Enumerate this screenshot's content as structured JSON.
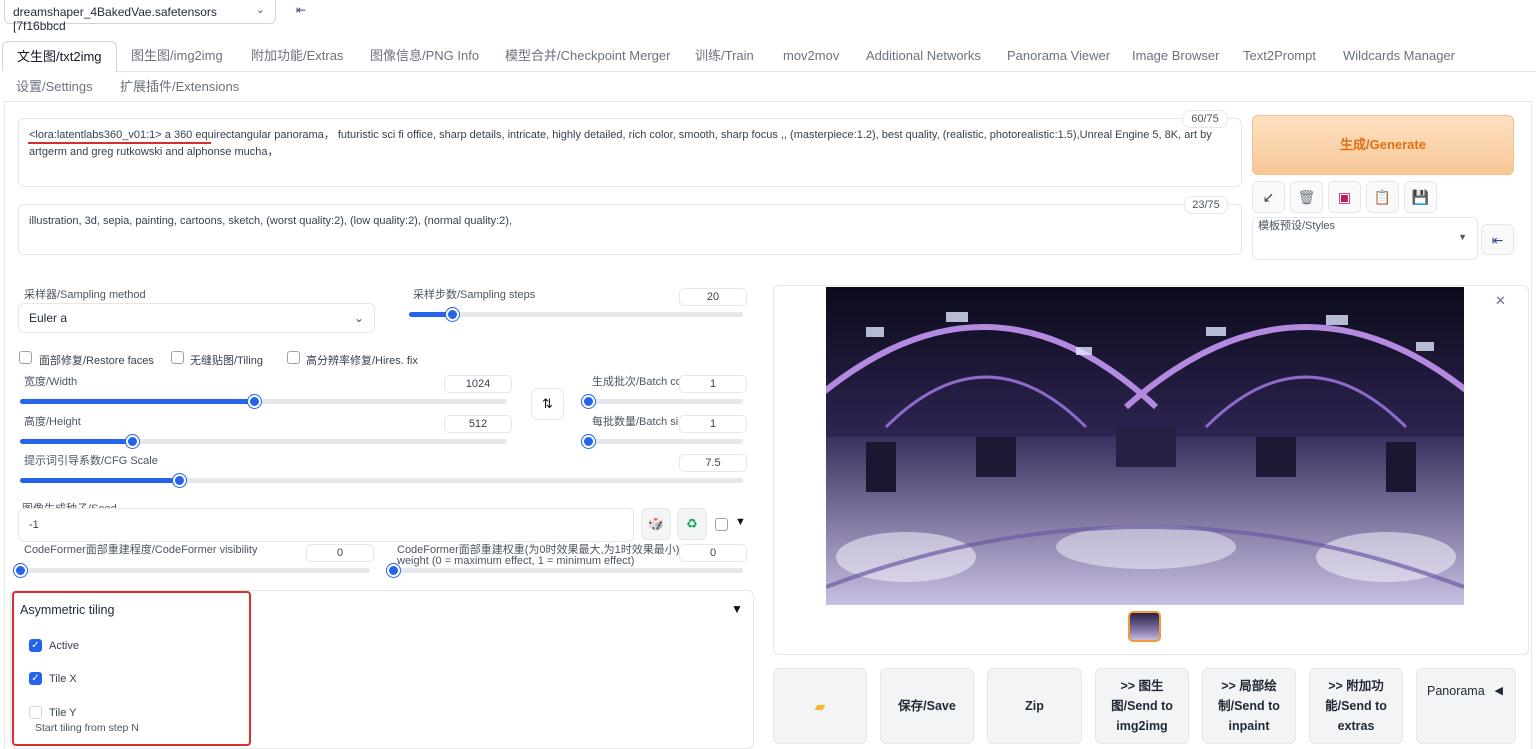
{
  "model": {
    "name": "dreamshaper_4BakedVae.safetensors [7f16bbcd"
  },
  "tabs": {
    "row1": [
      "文生图/txt2img",
      "图生图/img2img",
      "附加功能/Extras",
      "图像信息/PNG Info",
      "模型合并/Checkpoint Merger",
      "训练/Train",
      "mov2mov",
      "Additional Networks",
      "Panorama Viewer",
      "Image Browser",
      "Text2Prompt",
      "Wildcards Manager"
    ],
    "row2": [
      "设置/Settings",
      "扩展插件/Extensions"
    ]
  },
  "prompt": {
    "lora_tag": "<lora:latentlabs360_v01:1>",
    "text": " a 360 equirectangular panorama，   futuristic sci fi office, sharp details, intricate, highly detailed, rich color, smooth, sharp focus ,, (masterpiece:1.2), best quality, (realistic, photorealistic:1.5),Unreal Engine 5, 8K, art by artgerm and greg rutkowski and alphonse mucha，",
    "counter": "60/75"
  },
  "negative_prompt": {
    "text": "illustration, 3d, sepia, painting, cartoons, sketch, (worst quality:2), (low quality:2), (normal quality:2),",
    "counter": "23/75"
  },
  "generate_label": "生成/Generate",
  "tool_icons": [
    "arrow-icon",
    "trash-icon",
    "card-icon",
    "clipboard-icon",
    "save-icon"
  ],
  "styles": {
    "label": "模板预设/Styles"
  },
  "sampling": {
    "method_label": "采样器/Sampling method",
    "method_value": "Euler a",
    "steps_label": "采样步数/Sampling steps",
    "steps_value": "20",
    "steps_fraction": 0.13
  },
  "options": {
    "restore_faces": "面部修复/Restore faces",
    "tiling": "无缝贴图/Tiling",
    "hires_fix": "高分辨率修复/Hires. fix"
  },
  "width": {
    "label": "宽度/Width",
    "value": "1024",
    "fraction": 0.48
  },
  "height": {
    "label": "高度/Height",
    "value": "512",
    "fraction": 0.23
  },
  "batch_count": {
    "label": "生成批次/Batch co",
    "value": "1",
    "fraction": 0.0
  },
  "batch_size": {
    "label": "每批数量/Batch si",
    "value": "1",
    "fraction": 0.0
  },
  "cfg": {
    "label": "提示词引导系数/CFG Scale",
    "value": "7.5",
    "fraction": 0.22
  },
  "seed": {
    "label": "图像生成种子/Seed",
    "value": "-1"
  },
  "codeformer_visibility": {
    "label": "CodeFormer面部重建程度/CodeFormer visibility",
    "value": "0"
  },
  "codeformer_weight": {
    "label_line1": "CodeFormer面部重建权重(为0时效果最大,为1时效果最小)/",
    "label_line2": "weight (0 = maximum effect, 1 = minimum effect)",
    "value": "0"
  },
  "asymmetric_tiling": {
    "title": "Asymmetric tiling",
    "active_label": "Active",
    "tile_x_label": "Tile X",
    "tile_y_label": "Tile Y",
    "start_label": "Start tiling from step N"
  },
  "output_buttons": {
    "save": "保存/Save",
    "zip": "Zip",
    "send_img2img_1": ">> 图生",
    "send_img2img_2": "图/Send to",
    "send_img2img_3": "img2img",
    "send_inpaint_1": ">> 局部绘",
    "send_inpaint_2": "制/Send to",
    "send_inpaint_3": "inpaint",
    "send_extras_1": ">> 附加功",
    "send_extras_2": "能/Send to",
    "send_extras_3": "extras",
    "panorama": "Panorama"
  }
}
